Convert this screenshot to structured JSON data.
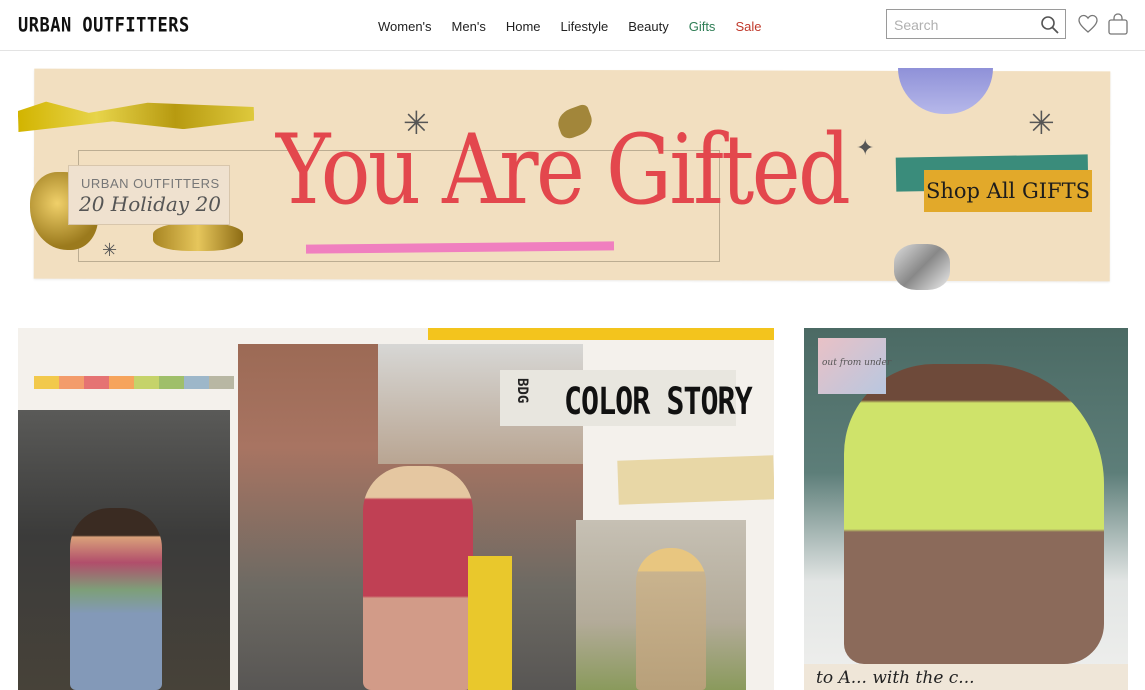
{
  "header": {
    "logo": "URBAN OUTFITTERS",
    "nav": [
      {
        "label": "Women's"
      },
      {
        "label": "Men's"
      },
      {
        "label": "Home"
      },
      {
        "label": "Lifestyle"
      },
      {
        "label": "Beauty"
      },
      {
        "label": "Gifts",
        "color": "#2e7d55"
      },
      {
        "label": "Sale",
        "color": "#c0392b"
      }
    ],
    "search_placeholder": "Search"
  },
  "banner": {
    "headline": "You Are Gifted",
    "holiday_brand": "URBAN OUTFITTERS",
    "holiday_text": "20 Holiday 20",
    "cta": "Shop All GIFTS",
    "headline_color": "#e3474d",
    "cta_color": "#e2a92a"
  },
  "promo_main": {
    "bdg": "BDG",
    "title": "COLOR STORY"
  },
  "promo_side": {
    "card_text": "out from under",
    "script": "to A... with the c..."
  },
  "colors": {
    "swatches": [
      "#f2c94c",
      "#f39c6b",
      "#e57373",
      "#f6a45c",
      "#c5d36a",
      "#9fbf6a",
      "#9db7c9",
      "#b8b7a3"
    ]
  }
}
